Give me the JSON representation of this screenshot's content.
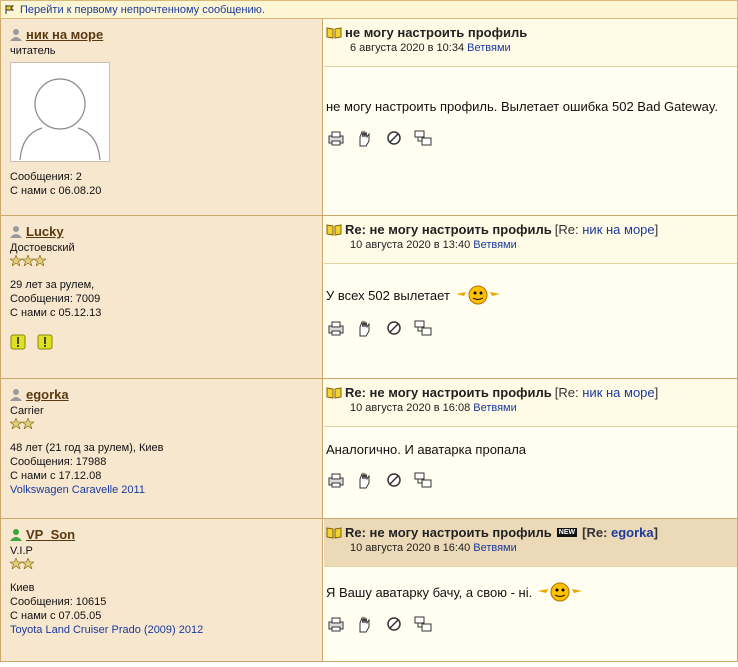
{
  "topbar": {
    "link": "Перейти к первому непрочтенному сообщению."
  },
  "common": {
    "date_mid": " в ",
    "branches": "Ветвями"
  },
  "posts": [
    {
      "user": {
        "name": "ник на море",
        "role": "читатель",
        "stars": 0,
        "online": false,
        "meta": [
          "Сообщения: 2",
          "С нами с 06.08.20"
        ],
        "car": ""
      },
      "subject": "не могу настроить профиль",
      "reply_prefix": "",
      "reply_user": "",
      "reply_suffix": "",
      "is_new": false,
      "date": "6 августа 2020 в 10:34",
      "text": "не могу настроить профиль. Вылетает ошибка 502 Bad Gateway.",
      "smiley": false
    },
    {
      "user": {
        "name": "Lucky",
        "role": "Достоевский",
        "stars": 3,
        "online": false,
        "meta": [
          "29 лет за рулем,",
          "Сообщения: 7009",
          "С нами с 05.12.13"
        ],
        "car": ""
      },
      "subject": "Re: не могу настроить профиль",
      "reply_prefix": "[Re: ",
      "reply_user": "ник на море",
      "reply_suffix": "]",
      "is_new": false,
      "date": "10 августа 2020 в 13:40",
      "text": "У всех 502 вылетает",
      "smiley": true
    },
    {
      "user": {
        "name": "egorka",
        "role": "Carrier",
        "stars": 2,
        "online": false,
        "meta": [
          "48 лет (21 год за рулем), Киев",
          "Сообщения: 17988",
          "С нами с 17.12.08"
        ],
        "car": "Volkswagen Caravelle 2011"
      },
      "subject": "Re: не могу настроить профиль",
      "reply_prefix": "[Re: ",
      "reply_user": "ник на море",
      "reply_suffix": "]",
      "is_new": false,
      "date": "10 августа 2020 в 16:08",
      "text": "Аналогично. И аватарка пропала",
      "smiley": false
    },
    {
      "user": {
        "name": "VP_Son",
        "role": "V.I.P",
        "stars": 2,
        "online": true,
        "meta": [
          "Киев",
          "Сообщения: 10615",
          "С нами с 07.05.05"
        ],
        "car": "Toyota Land Cruiser Prado (2009) 2012"
      },
      "subject": "Re: не могу настроить профиль",
      "reply_prefix": "[Re: ",
      "reply_user": "egorka",
      "reply_suffix": "]",
      "is_new": true,
      "new_badge": "NEW",
      "date": "10 августа 2020 в 16:40",
      "text": "Я Вашу аватарку бачу, а свою - ні.",
      "smiley": true
    }
  ],
  "colors": {
    "left_bg": "#f7e7cf",
    "right_bg": "#fffef0",
    "border": "#c9a86a",
    "link": "#1a3a9c",
    "online": "#3aa53a",
    "offline": "#9a9a9a"
  }
}
